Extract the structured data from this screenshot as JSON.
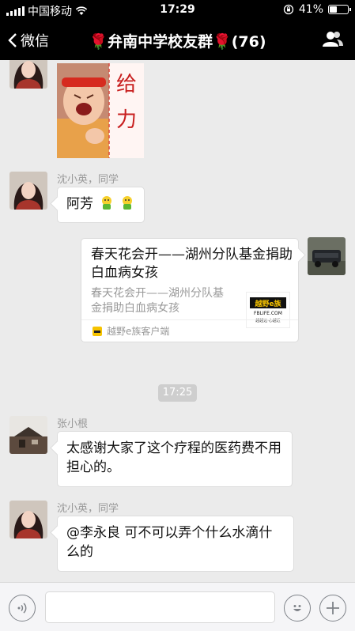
{
  "status_bar": {
    "carrier": "中国移动",
    "time": "17:29",
    "battery": "41%",
    "battery_level": 0.41
  },
  "nav": {
    "back_label": "微信",
    "title": "🌹弁南中学校友群🌹(76)"
  },
  "messages": [
    {
      "sender": "沈小英，同学",
      "text": "阿芳"
    },
    {
      "sender": "张小根",
      "text": "太感谢大家了这个疗程的医药费不用担心的。"
    },
    {
      "sender": "沈小英，同学",
      "text": "@李永良 可不可以弄个什么水滴什么的"
    }
  ],
  "sticker": {
    "caption": "给力"
  },
  "link_card": {
    "title": "春天花会开——湖州分队基金捐助白血病女孩",
    "description": "春天花会开——湖州分队基金捐助白血病女孩",
    "source": "越野e族客户端",
    "logo_text": "越野e族",
    "logo_sub": "FBLIFE.COM",
    "logo_slogan": "越越远·心越近"
  },
  "time_separator": "17:25"
}
